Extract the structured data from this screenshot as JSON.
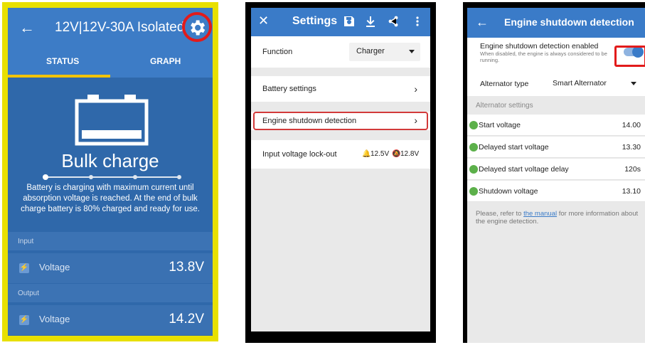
{
  "panel1": {
    "title": "12V|12V-30A Isolated",
    "tabs": [
      "STATUS",
      "GRAPH"
    ],
    "state_title": "Bulk charge",
    "state_description": "Battery is charging with maximum current until absorption voltage is reached. At the end of bulk charge battery is  80% charged and ready for use.",
    "input_label": "Input",
    "output_label": "Output",
    "input_row": {
      "label": "Voltage",
      "value": "13.8V"
    },
    "output_row": {
      "label": "Voltage",
      "value": "14.2V"
    },
    "colors": {
      "header": "#3d7cc6",
      "body": "#2f68aa",
      "highlight": "#e21b1b",
      "frame": "#e8e000"
    }
  },
  "panel2": {
    "title": "Settings",
    "function_label": "Function",
    "function_value": "Charger",
    "battery_settings": "Battery settings",
    "engine_shutdown": "Engine shutdown detection",
    "lockout_label": "Input voltage lock-out",
    "lockout_on": "12.5V",
    "lockout_off": "12.8V"
  },
  "panel3": {
    "title": "Engine shutdown detection",
    "enabled_title": "Engine shutdown detection enabled",
    "enabled_subtitle": "When disabled, the engine is always considered to be running.",
    "alternator_label": "Alternator type",
    "alternator_value": "Smart Alternator",
    "alternator_settings": "Alternator settings",
    "settings": [
      {
        "label": "Start voltage",
        "value": "14.00"
      },
      {
        "label": "Delayed start voltage",
        "value": "13.30"
      },
      {
        "label": "Delayed start voltage delay",
        "value": "120s"
      },
      {
        "label": "Shutdown voltage",
        "value": "13.10"
      }
    ],
    "note_prefix": "Please, refer to ",
    "note_link": "the manual",
    "note_suffix": " for more information about the engine detection."
  }
}
